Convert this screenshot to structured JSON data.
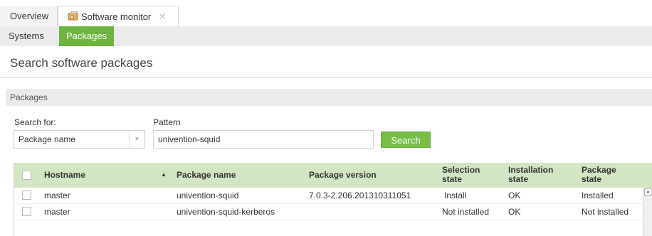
{
  "tabs": [
    {
      "label": "Overview"
    },
    {
      "label": "Software monitor",
      "close": "✕"
    }
  ],
  "subnav": {
    "systems": "Systems",
    "packages": "Packages"
  },
  "page": {
    "title": "Search software packages"
  },
  "section": {
    "title": "Packages"
  },
  "form": {
    "search_for_label": "Search for:",
    "search_for_value": "Package name",
    "pattern_label": "Pattern",
    "pattern_value": "univention-squid",
    "search_button": "Search"
  },
  "grid": {
    "columns": {
      "hostname": "Hostname",
      "package_name": "Package name",
      "package_version": "Package version",
      "selection_state_1": "Selection",
      "selection_state_2": "state",
      "installation_state_1": "Installation",
      "installation_state_2": "state",
      "package_state_1": "Package",
      "package_state_2": "state"
    },
    "sort_indicator": "▲",
    "rows": [
      {
        "hostname": "master",
        "package_name": "univention-squid",
        "package_version": "7.0.3-2.206.201310311051",
        "selection_state": "Install",
        "installation_state": "OK",
        "package_state": "Installed"
      },
      {
        "hostname": "master",
        "package_name": "univention-squid-kerberos",
        "package_version": "",
        "selection_state": "Not installed",
        "installation_state": "OK",
        "package_state": "Not installed"
      }
    ]
  },
  "colors": {
    "accent": "#6fb43f",
    "grid_header": "#d3e6c4",
    "button": "#76be48"
  }
}
